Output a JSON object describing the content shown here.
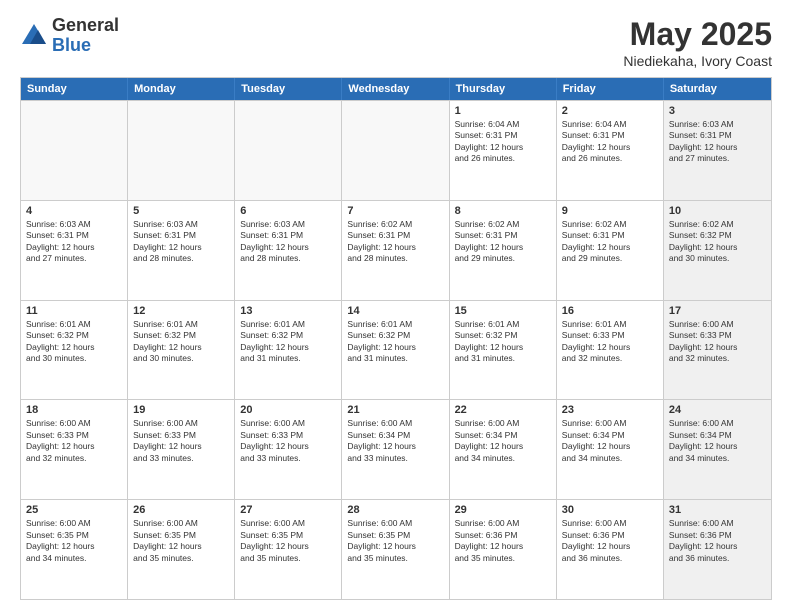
{
  "logo": {
    "general": "General",
    "blue": "Blue"
  },
  "title": "May 2025",
  "location": "Niediekaha, Ivory Coast",
  "header_days": [
    "Sunday",
    "Monday",
    "Tuesday",
    "Wednesday",
    "Thursday",
    "Friday",
    "Saturday"
  ],
  "rows": [
    [
      {
        "day": "",
        "info": "",
        "empty": true
      },
      {
        "day": "",
        "info": "",
        "empty": true
      },
      {
        "day": "",
        "info": "",
        "empty": true
      },
      {
        "day": "",
        "info": "",
        "empty": true
      },
      {
        "day": "1",
        "info": "Sunrise: 6:04 AM\nSunset: 6:31 PM\nDaylight: 12 hours\nand 26 minutes.",
        "empty": false
      },
      {
        "day": "2",
        "info": "Sunrise: 6:04 AM\nSunset: 6:31 PM\nDaylight: 12 hours\nand 26 minutes.",
        "empty": false
      },
      {
        "day": "3",
        "info": "Sunrise: 6:03 AM\nSunset: 6:31 PM\nDaylight: 12 hours\nand 27 minutes.",
        "empty": false,
        "shaded": true
      }
    ],
    [
      {
        "day": "4",
        "info": "Sunrise: 6:03 AM\nSunset: 6:31 PM\nDaylight: 12 hours\nand 27 minutes.",
        "empty": false
      },
      {
        "day": "5",
        "info": "Sunrise: 6:03 AM\nSunset: 6:31 PM\nDaylight: 12 hours\nand 28 minutes.",
        "empty": false
      },
      {
        "day": "6",
        "info": "Sunrise: 6:03 AM\nSunset: 6:31 PM\nDaylight: 12 hours\nand 28 minutes.",
        "empty": false
      },
      {
        "day": "7",
        "info": "Sunrise: 6:02 AM\nSunset: 6:31 PM\nDaylight: 12 hours\nand 28 minutes.",
        "empty": false
      },
      {
        "day": "8",
        "info": "Sunrise: 6:02 AM\nSunset: 6:31 PM\nDaylight: 12 hours\nand 29 minutes.",
        "empty": false
      },
      {
        "day": "9",
        "info": "Sunrise: 6:02 AM\nSunset: 6:31 PM\nDaylight: 12 hours\nand 29 minutes.",
        "empty": false
      },
      {
        "day": "10",
        "info": "Sunrise: 6:02 AM\nSunset: 6:32 PM\nDaylight: 12 hours\nand 30 minutes.",
        "empty": false,
        "shaded": true
      }
    ],
    [
      {
        "day": "11",
        "info": "Sunrise: 6:01 AM\nSunset: 6:32 PM\nDaylight: 12 hours\nand 30 minutes.",
        "empty": false
      },
      {
        "day": "12",
        "info": "Sunrise: 6:01 AM\nSunset: 6:32 PM\nDaylight: 12 hours\nand 30 minutes.",
        "empty": false
      },
      {
        "day": "13",
        "info": "Sunrise: 6:01 AM\nSunset: 6:32 PM\nDaylight: 12 hours\nand 31 minutes.",
        "empty": false
      },
      {
        "day": "14",
        "info": "Sunrise: 6:01 AM\nSunset: 6:32 PM\nDaylight: 12 hours\nand 31 minutes.",
        "empty": false
      },
      {
        "day": "15",
        "info": "Sunrise: 6:01 AM\nSunset: 6:32 PM\nDaylight: 12 hours\nand 31 minutes.",
        "empty": false
      },
      {
        "day": "16",
        "info": "Sunrise: 6:01 AM\nSunset: 6:33 PM\nDaylight: 12 hours\nand 32 minutes.",
        "empty": false
      },
      {
        "day": "17",
        "info": "Sunrise: 6:00 AM\nSunset: 6:33 PM\nDaylight: 12 hours\nand 32 minutes.",
        "empty": false,
        "shaded": true
      }
    ],
    [
      {
        "day": "18",
        "info": "Sunrise: 6:00 AM\nSunset: 6:33 PM\nDaylight: 12 hours\nand 32 minutes.",
        "empty": false
      },
      {
        "day": "19",
        "info": "Sunrise: 6:00 AM\nSunset: 6:33 PM\nDaylight: 12 hours\nand 33 minutes.",
        "empty": false
      },
      {
        "day": "20",
        "info": "Sunrise: 6:00 AM\nSunset: 6:33 PM\nDaylight: 12 hours\nand 33 minutes.",
        "empty": false
      },
      {
        "day": "21",
        "info": "Sunrise: 6:00 AM\nSunset: 6:34 PM\nDaylight: 12 hours\nand 33 minutes.",
        "empty": false
      },
      {
        "day": "22",
        "info": "Sunrise: 6:00 AM\nSunset: 6:34 PM\nDaylight: 12 hours\nand 34 minutes.",
        "empty": false
      },
      {
        "day": "23",
        "info": "Sunrise: 6:00 AM\nSunset: 6:34 PM\nDaylight: 12 hours\nand 34 minutes.",
        "empty": false
      },
      {
        "day": "24",
        "info": "Sunrise: 6:00 AM\nSunset: 6:34 PM\nDaylight: 12 hours\nand 34 minutes.",
        "empty": false,
        "shaded": true
      }
    ],
    [
      {
        "day": "25",
        "info": "Sunrise: 6:00 AM\nSunset: 6:35 PM\nDaylight: 12 hours\nand 34 minutes.",
        "empty": false
      },
      {
        "day": "26",
        "info": "Sunrise: 6:00 AM\nSunset: 6:35 PM\nDaylight: 12 hours\nand 35 minutes.",
        "empty": false
      },
      {
        "day": "27",
        "info": "Sunrise: 6:00 AM\nSunset: 6:35 PM\nDaylight: 12 hours\nand 35 minutes.",
        "empty": false
      },
      {
        "day": "28",
        "info": "Sunrise: 6:00 AM\nSunset: 6:35 PM\nDaylight: 12 hours\nand 35 minutes.",
        "empty": false
      },
      {
        "day": "29",
        "info": "Sunrise: 6:00 AM\nSunset: 6:36 PM\nDaylight: 12 hours\nand 35 minutes.",
        "empty": false
      },
      {
        "day": "30",
        "info": "Sunrise: 6:00 AM\nSunset: 6:36 PM\nDaylight: 12 hours\nand 36 minutes.",
        "empty": false
      },
      {
        "day": "31",
        "info": "Sunrise: 6:00 AM\nSunset: 6:36 PM\nDaylight: 12 hours\nand 36 minutes.",
        "empty": false,
        "shaded": true
      }
    ]
  ]
}
